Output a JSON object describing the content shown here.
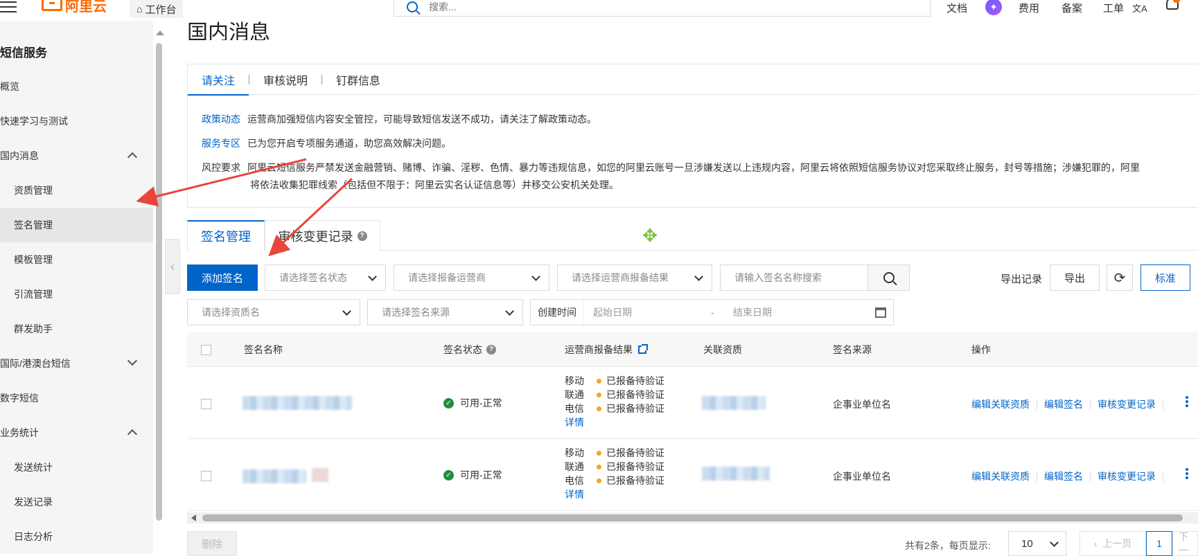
{
  "topbar": {
    "logo": "阿里云",
    "workbench": "工作台",
    "search_placeholder": "搜索...",
    "nav": [
      "文档",
      "费用",
      "备案",
      "工单"
    ],
    "translate_label": "文A",
    "ai_label": "✦"
  },
  "sidebar": {
    "title": "短信服务",
    "items": [
      {
        "label": "概览"
      },
      {
        "label": "快速学习与测试"
      },
      {
        "label": "国内消息"
      },
      {
        "label": "资质管理"
      },
      {
        "label": "签名管理"
      },
      {
        "label": "模板管理"
      },
      {
        "label": "引流管理"
      },
      {
        "label": "群发助手"
      },
      {
        "label": "国际/港澳台短信"
      },
      {
        "label": "数字短信"
      },
      {
        "label": "业务统计"
      },
      {
        "label": "发送统计"
      },
      {
        "label": "发送记录"
      },
      {
        "label": "日志分析"
      }
    ]
  },
  "main": {
    "title": "国内消息",
    "notice_tabs": [
      "请关注",
      "审核说明",
      "钉群信息"
    ],
    "notices": [
      {
        "key": "政策动态",
        "text": "运营商加强短信内容安全管控，可能导致短信发送不成功，请关注了解政策动态。"
      },
      {
        "key": "服务专区",
        "text": "已为您开启专项服务通道，助您高效解决问题。"
      },
      {
        "key": "风控要求",
        "text": "阿里云短信服务严禁发送金融营销、赌博、诈骗、淫秽、色情、暴力等违规信息，如您的阿里云账号一旦涉嫌发送以上违规内容，阿里云将依照短信服务协议对您采取终止服务，封号等措施；涉嫌犯罪的，阿里",
        "text2": "将依法收集犯罪线索（包括但不限于：阿里云实名认证信息等）并移交公安机关处理。"
      }
    ],
    "tabs": [
      "签名管理",
      "审核变更记录"
    ],
    "toolbar": {
      "add_button": "添加签名",
      "status_select": "请选择签名状态",
      "operator_select": "请选择报备运营商",
      "result_select": "请选择运营商报备结果",
      "search_placeholder": "请输入签名名称搜索",
      "export_records": "导出记录",
      "export": "导出",
      "standard": "标准",
      "qualification_select": "请选择资质名",
      "source_select": "请选择签名来源",
      "created_label": "创建时间",
      "start_date": "起始日期",
      "date_sep": "-",
      "end_date": "结束日期"
    },
    "table": {
      "columns": [
        "签名名称",
        "签名状态",
        "运营商报备结果",
        "关联资质",
        "签名来源",
        "操作"
      ],
      "rows": [
        {
          "status": "可用-正常",
          "carriers": [
            {
              "name": "移动",
              "result": "已报备待验证"
            },
            {
              "name": "联通",
              "result": "已报备待验证"
            },
            {
              "name": "电信",
              "result": "已报备待验证"
            }
          ],
          "detail": "详情",
          "source": "企事业单位名",
          "ops": [
            "编辑关联资质",
            "编辑签名",
            "审核变更记录"
          ]
        },
        {
          "status": "可用-正常",
          "carriers": [
            {
              "name": "移动",
              "result": "已报备待验证"
            },
            {
              "name": "联通",
              "result": "已报备待验证"
            },
            {
              "name": "电信",
              "result": "已报备待验证"
            }
          ],
          "detail": "详情",
          "source": "企事业单位名",
          "ops": [
            "编辑关联资质",
            "编辑签名",
            "审核变更记录"
          ]
        }
      ]
    },
    "footer": {
      "delete": "删除",
      "summary": "共有2条，每页显示:",
      "page_size": "10",
      "prev": "上一页",
      "current_page": "1",
      "next": "下一"
    }
  },
  "colors": {
    "accent": "#0064c8",
    "brand": "#ff6a00",
    "arrow": "#e8453c",
    "success": "#1e8e3e",
    "pending": "#f5a623"
  }
}
